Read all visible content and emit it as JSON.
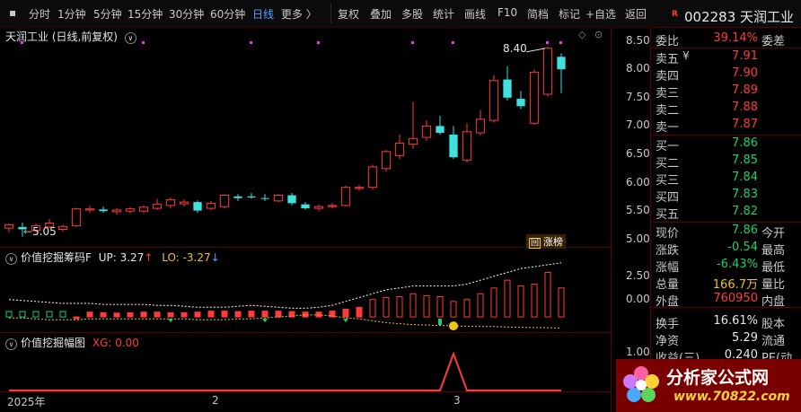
{
  "toolbar": {
    "items": [
      {
        "label": "分时"
      },
      {
        "label": "1分钟"
      },
      {
        "label": "5分钟"
      },
      {
        "label": "15分钟"
      },
      {
        "label": "30分钟"
      },
      {
        "label": "60分钟"
      },
      {
        "label": "日线"
      },
      {
        "label": "更多 〉"
      },
      {
        "label": "复权"
      },
      {
        "label": "叠加"
      },
      {
        "label": "多股"
      },
      {
        "label": "统计"
      },
      {
        "label": "画线"
      },
      {
        "label": "F10"
      },
      {
        "label": "简档"
      },
      {
        "label": "标记"
      },
      {
        "label": "+自选"
      },
      {
        "label": "返回"
      }
    ]
  },
  "main_chart": {
    "title": "天润工业 (日线,前复权)",
    "high_label": "8.40",
    "low_label": "5.05",
    "badge_icon": "回",
    "badge": "涨榜",
    "y_ticks": [
      "8.50",
      "8.00",
      "7.50",
      "7.00",
      "6.50",
      "6.00",
      "5.50",
      "5.00"
    ]
  },
  "indicator1": {
    "name": "价值挖掘筹码F",
    "up_label": "UP: 3.27",
    "lo_label": "LO: -3.27",
    "y_ticks": [
      "2.50",
      "0.00"
    ]
  },
  "indicator2": {
    "name": "价值挖掘幅图",
    "xg_label": "XG: 0.00",
    "y_ticks": [
      "1.00"
    ]
  },
  "x_axis": {
    "labels": [
      "2025年",
      "2",
      "3"
    ]
  },
  "quote": {
    "code_tag": "R",
    "stock": "002283 天润工业",
    "weibi_label": "委比",
    "weibi": "39.14%",
    "weicha_label": "委差",
    "asks": [
      {
        "label": "卖五",
        "mark": "¥",
        "price": "7.91"
      },
      {
        "label": "卖四",
        "mark": "",
        "price": "7.90"
      },
      {
        "label": "卖三",
        "mark": "",
        "price": "7.89"
      },
      {
        "label": "卖二",
        "mark": "",
        "price": "7.88"
      },
      {
        "label": "卖一",
        "mark": "",
        "price": "7.87"
      }
    ],
    "bids": [
      {
        "label": "买一",
        "price": "7.86"
      },
      {
        "label": "买二",
        "price": "7.85"
      },
      {
        "label": "买三",
        "price": "7.84"
      },
      {
        "label": "买四",
        "price": "7.83"
      },
      {
        "label": "买五",
        "price": "7.82"
      }
    ],
    "stats": [
      {
        "label": "现价",
        "value": "7.86",
        "tail": "今开",
        "cls": "green"
      },
      {
        "label": "涨跌",
        "value": "-0.54",
        "tail": "最高",
        "cls": "green"
      },
      {
        "label": "涨幅",
        "value": "-6.43%",
        "tail": "最低",
        "cls": "green"
      },
      {
        "label": "总量",
        "value": "166.7万",
        "tail": "量比",
        "cls": "yellow"
      },
      {
        "label": "外盘",
        "value": "760950",
        "tail": "内盘",
        "cls": "red"
      },
      {
        "label": "换手",
        "value": "16.61%",
        "tail": "股本",
        "cls": "white"
      },
      {
        "label": "净资",
        "value": "5.29",
        "tail": "流通",
        "cls": "white"
      },
      {
        "label": "收益(三)",
        "value": "0.240",
        "tail": "PE(动",
        "cls": "white"
      }
    ]
  },
  "watermark": {
    "brand": "分析家公式网",
    "url": "www.70822.com"
  },
  "colors": {
    "up": "#ff3b3b",
    "down": "#3fe0e0",
    "accent": "#5aa0ff",
    "magenta": "#e040e0"
  },
  "chart_data": {
    "type": "candlestick",
    "y_range": [
      4.95,
      8.62
    ],
    "candles": [
      {
        "o": 5.2,
        "h": 5.28,
        "l": 5.13,
        "c": 5.26
      },
      {
        "o": 5.22,
        "h": 5.3,
        "l": 5.05,
        "c": 5.18
      },
      {
        "o": 5.16,
        "h": 5.28,
        "l": 5.12,
        "c": 5.24
      },
      {
        "o": 5.22,
        "h": 5.36,
        "l": 5.2,
        "c": 5.29
      },
      {
        "o": 5.18,
        "h": 5.26,
        "l": 5.14,
        "c": 5.23
      },
      {
        "o": 5.24,
        "h": 5.56,
        "l": 5.22,
        "c": 5.54
      },
      {
        "o": 5.52,
        "h": 5.59,
        "l": 5.47,
        "c": 5.54
      },
      {
        "o": 5.53,
        "h": 5.58,
        "l": 5.47,
        "c": 5.5
      },
      {
        "o": 5.49,
        "h": 5.55,
        "l": 5.44,
        "c": 5.52
      },
      {
        "o": 5.5,
        "h": 5.57,
        "l": 5.46,
        "c": 5.54
      },
      {
        "o": 5.5,
        "h": 5.6,
        "l": 5.47,
        "c": 5.57
      },
      {
        "o": 5.55,
        "h": 5.72,
        "l": 5.52,
        "c": 5.62
      },
      {
        "o": 5.6,
        "h": 5.74,
        "l": 5.55,
        "c": 5.7
      },
      {
        "o": 5.63,
        "h": 5.71,
        "l": 5.58,
        "c": 5.66
      },
      {
        "o": 5.66,
        "h": 5.69,
        "l": 5.47,
        "c": 5.51
      },
      {
        "o": 5.55,
        "h": 5.68,
        "l": 5.52,
        "c": 5.64
      },
      {
        "o": 5.58,
        "h": 5.8,
        "l": 5.55,
        "c": 5.78
      },
      {
        "o": 5.76,
        "h": 5.8,
        "l": 5.68,
        "c": 5.73
      },
      {
        "o": 5.76,
        "h": 5.82,
        "l": 5.72,
        "c": 5.74
      },
      {
        "o": 5.73,
        "h": 5.8,
        "l": 5.68,
        "c": 5.72
      },
      {
        "o": 5.68,
        "h": 5.8,
        "l": 5.66,
        "c": 5.78
      },
      {
        "o": 5.78,
        "h": 5.82,
        "l": 5.6,
        "c": 5.64
      },
      {
        "o": 5.62,
        "h": 5.66,
        "l": 5.53,
        "c": 5.55
      },
      {
        "o": 5.55,
        "h": 5.62,
        "l": 5.5,
        "c": 5.58
      },
      {
        "o": 5.58,
        "h": 5.64,
        "l": 5.55,
        "c": 5.6
      },
      {
        "o": 5.6,
        "h": 5.95,
        "l": 5.58,
        "c": 5.92
      },
      {
        "o": 5.9,
        "h": 5.96,
        "l": 5.86,
        "c": 5.92
      },
      {
        "o": 5.92,
        "h": 6.32,
        "l": 5.88,
        "c": 6.28
      },
      {
        "o": 6.25,
        "h": 6.58,
        "l": 6.2,
        "c": 6.55
      },
      {
        "o": 6.48,
        "h": 6.85,
        "l": 6.42,
        "c": 6.7
      },
      {
        "o": 6.68,
        "h": 7.42,
        "l": 6.6,
        "c": 6.78
      },
      {
        "o": 6.8,
        "h": 7.1,
        "l": 6.74,
        "c": 7.0
      },
      {
        "o": 7.0,
        "h": 7.18,
        "l": 6.85,
        "c": 6.88
      },
      {
        "o": 6.85,
        "h": 7.0,
        "l": 6.42,
        "c": 6.45
      },
      {
        "o": 6.4,
        "h": 7.05,
        "l": 6.36,
        "c": 6.9
      },
      {
        "o": 6.88,
        "h": 7.28,
        "l": 6.84,
        "c": 7.12
      },
      {
        "o": 7.1,
        "h": 7.9,
        "l": 7.06,
        "c": 7.8
      },
      {
        "o": 7.82,
        "h": 8.05,
        "l": 7.45,
        "c": 7.5
      },
      {
        "o": 7.48,
        "h": 7.62,
        "l": 7.3,
        "c": 7.35
      },
      {
        "o": 7.05,
        "h": 8.0,
        "l": 7.02,
        "c": 7.95
      },
      {
        "o": 7.56,
        "h": 8.4,
        "l": 7.52,
        "c": 8.37
      },
      {
        "o": 8.22,
        "h": 8.28,
        "l": 7.58,
        "c": 8.0
      }
    ],
    "indicator1": {
      "y_range": [
        -0.6,
        3.3
      ],
      "bars": [
        0,
        0,
        0,
        0,
        0,
        0,
        0.25,
        0.22,
        0.2,
        0.22,
        0.25,
        0.25,
        0.22,
        0.22,
        0.25,
        0.3,
        0.3,
        0.28,
        0.3,
        0.3,
        0.3,
        0.28,
        0.25,
        0.25,
        0.3,
        0.4,
        0.5,
        0.9,
        1.0,
        1.05,
        1.2,
        1.1,
        1.05,
        0.8,
        0.9,
        1.2,
        1.5,
        1.9,
        1.6,
        1.7,
        2.3,
        1.5
      ],
      "bar_up": [
        false,
        false,
        false,
        false,
        false,
        true,
        true,
        true,
        true,
        true,
        true,
        true,
        true,
        true,
        true,
        true,
        true,
        true,
        true,
        true,
        true,
        true,
        true,
        true,
        true,
        true,
        true,
        true,
        true,
        true,
        true,
        true,
        true,
        true,
        true,
        true,
        true,
        true,
        true,
        true,
        true,
        true
      ],
      "upper": [
        0.9,
        0.85,
        0.8,
        0.75,
        0.7,
        0.7,
        0.7,
        0.65,
        0.65,
        0.65,
        0.65,
        0.6,
        0.6,
        0.55,
        0.5,
        0.5,
        0.5,
        0.55,
        0.6,
        0.55,
        0.5,
        0.45,
        0.45,
        0.5,
        0.6,
        0.8,
        1.0,
        1.2,
        1.4,
        1.5,
        1.6,
        1.6,
        1.6,
        1.6,
        1.7,
        1.9,
        2.1,
        2.3,
        2.5,
        2.6,
        2.7,
        2.8
      ],
      "lower": [
        -0.05,
        -0.05,
        -0.1,
        -0.15,
        -0.15,
        -0.15,
        -0.1,
        -0.1,
        -0.1,
        -0.1,
        -0.1,
        -0.1,
        -0.1,
        -0.1,
        -0.15,
        -0.15,
        -0.15,
        -0.1,
        -0.1,
        -0.05,
        0.0,
        0.05,
        0.1,
        0.1,
        0.05,
        -0.05,
        -0.1,
        -0.2,
        -0.3,
        -0.35,
        -0.4,
        -0.42,
        -0.44,
        -0.46,
        -0.48,
        -0.5,
        -0.5,
        -0.52,
        -0.54,
        -0.55,
        -0.56,
        -0.57
      ]
    },
    "indicator2": {
      "y_range": [
        0,
        1.1
      ],
      "values": [
        0,
        0,
        0,
        0,
        0,
        0,
        0,
        0,
        0,
        0,
        0,
        0,
        0,
        0,
        0,
        0,
        0,
        0,
        0,
        0,
        0,
        0,
        0,
        0,
        0,
        0,
        0,
        0,
        0,
        0,
        0,
        0,
        0,
        1,
        0,
        0,
        0,
        0,
        0,
        0,
        0,
        0
      ]
    }
  }
}
